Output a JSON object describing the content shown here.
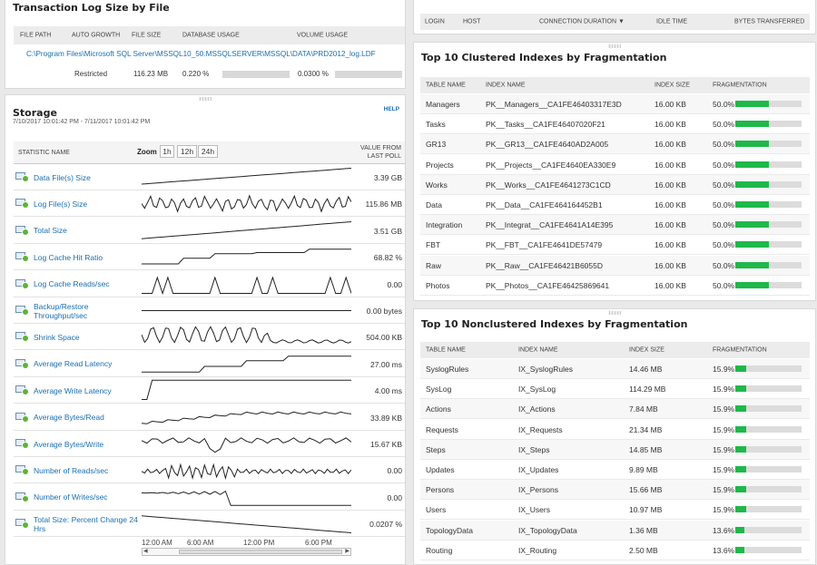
{
  "transaction_log": {
    "title": "Transaction Log Size by File",
    "headers": [
      "FILE PATH",
      "AUTO GROWTH",
      "FILE SIZE",
      "DATABASE USAGE",
      "VOLUME USAGE"
    ],
    "file_path": "C:\\Program Files\\Microsoft SQL Server\\MSSQL10_50.MSSQLSERVER\\MSSQL\\DATA\\PRD2012_log.LDF",
    "auto_growth": "Restricted",
    "file_size": "116.23 MB",
    "database_usage": "0.220 %",
    "volume_usage": "0.0300 %"
  },
  "storage": {
    "title": "Storage",
    "date_range": "7/10/2017 10:01:42 PM - 7/11/2017 10:01:42 PM",
    "help": "HELP",
    "col_stat": "STATISTIC NAME",
    "zoom_label": "Zoom",
    "zoom_options": [
      "1h",
      "12h",
      "24h"
    ],
    "col_value_1": "VALUE FROM",
    "col_value_2": "LAST POLL",
    "rows": [
      {
        "name": "Data File(s) Size",
        "value": "3.39 GB"
      },
      {
        "name": "Log File(s) Size",
        "value": "115.86 MB"
      },
      {
        "name": "Total Size",
        "value": "3.51 GB"
      },
      {
        "name": "Log Cache Hit Ratio",
        "value": "68.82 %"
      },
      {
        "name": "Log Cache Reads/sec",
        "value": "0.00"
      },
      {
        "name": "Backup/Restore Throughput/sec",
        "value": "0.00 bytes"
      },
      {
        "name": "Shrink Space",
        "value": "504.00 KB"
      },
      {
        "name": "Average Read Latency",
        "value": "27.00 ms"
      },
      {
        "name": "Average Write Latency",
        "value": "4.00 ms"
      },
      {
        "name": "Average Bytes/Read",
        "value": "33.89 KB"
      },
      {
        "name": "Average Bytes/Write",
        "value": "15.67 KB"
      },
      {
        "name": "Number of Reads/sec",
        "value": "0.00"
      },
      {
        "name": "Number of Writes/sec",
        "value": "0.00"
      },
      {
        "name": "Total Size: Percent Change 24 Hrs",
        "value": "0.0207 %"
      }
    ],
    "axis_ticks": [
      "12:00 AM",
      "6:00 AM",
      "12:00 PM",
      "6:00 PM"
    ]
  },
  "connections": {
    "headers": [
      "LOGIN",
      "HOST",
      "CONNECTION DURATION",
      "IDLE TIME",
      "BYTES TRANSFERRED"
    ]
  },
  "clustered": {
    "title": "Top 10 Clustered Indexes by Fragmentation",
    "headers": [
      "TABLE NAME",
      "INDEX NAME",
      "INDEX SIZE",
      "FRAGMENTATION"
    ],
    "rows": [
      {
        "table": "Managers",
        "index": "PK__Managers__CA1FE46403317E3D",
        "size": "16.00 KB",
        "frag": "50.0%",
        "frag_value": 50.0
      },
      {
        "table": "Tasks",
        "index": "PK__Tasks__CA1FE46407020F21",
        "size": "16.00 KB",
        "frag": "50.0%",
        "frag_value": 50.0
      },
      {
        "table": "GR13",
        "index": "PK__GR13__CA1FE4640AD2A005",
        "size": "16.00 KB",
        "frag": "50.0%",
        "frag_value": 50.0
      },
      {
        "table": "Projects",
        "index": "PK__Projects__CA1FE4640EA330E9",
        "size": "16.00 KB",
        "frag": "50.0%",
        "frag_value": 50.0
      },
      {
        "table": "Works",
        "index": "PK__Works__CA1FE4641273C1CD",
        "size": "16.00 KB",
        "frag": "50.0%",
        "frag_value": 50.0
      },
      {
        "table": "Data",
        "index": "PK__Data__CA1FE464164452B1",
        "size": "16.00 KB",
        "frag": "50.0%",
        "frag_value": 50.0
      },
      {
        "table": "Integration",
        "index": "PK__Integrat__CA1FE4641A14E395",
        "size": "16.00 KB",
        "frag": "50.0%",
        "frag_value": 50.0
      },
      {
        "table": "FBT",
        "index": "PK__FBT__CA1FE4641DE57479",
        "size": "16.00 KB",
        "frag": "50.0%",
        "frag_value": 50.0
      },
      {
        "table": "Raw",
        "index": "PK__Raw__CA1FE46421B6055D",
        "size": "16.00 KB",
        "frag": "50.0%",
        "frag_value": 50.0
      },
      {
        "table": "Photos",
        "index": "PK__Photos__CA1FE46425869641",
        "size": "16.00 KB",
        "frag": "50.0%",
        "frag_value": 50.0
      }
    ]
  },
  "nonclustered": {
    "title": "Top 10 Nonclustered Indexes by Fragmentation",
    "headers": [
      "TABLE NAME",
      "INDEX NAME",
      "INDEX SIZE",
      "FRAGMENTATION"
    ],
    "rows": [
      {
        "table": "SyslogRules",
        "index": "IX_SyslogRules",
        "size": "14.46 MB",
        "frag": "15.9%",
        "frag_value": 15.9
      },
      {
        "table": "SysLog",
        "index": "IX_SysLog",
        "size": "114.29 MB",
        "frag": "15.9%",
        "frag_value": 15.9
      },
      {
        "table": "Actions",
        "index": "IX_Actions",
        "size": "7.84 MB",
        "frag": "15.9%",
        "frag_value": 15.9
      },
      {
        "table": "Requests",
        "index": "IX_Requests",
        "size": "21.34 MB",
        "frag": "15.9%",
        "frag_value": 15.9
      },
      {
        "table": "Steps",
        "index": "IX_Steps",
        "size": "14.85 MB",
        "frag": "15.9%",
        "frag_value": 15.9
      },
      {
        "table": "Updates",
        "index": "IX_Updates",
        "size": "9.89 MB",
        "frag": "15.9%",
        "frag_value": 15.9
      },
      {
        "table": "Persons",
        "index": "IX_Persons",
        "size": "15.66 MB",
        "frag": "15.9%",
        "frag_value": 15.9
      },
      {
        "table": "Users",
        "index": "IX_Users",
        "size": "10.97 MB",
        "frag": "15.9%",
        "frag_value": 15.9
      },
      {
        "table": "TopologyData",
        "index": "IX_TopologyData",
        "size": "1.36 MB",
        "frag": "13.6%",
        "frag_value": 13.6
      },
      {
        "table": "Routing",
        "index": "IX_Routing",
        "size": "2.50 MB",
        "frag": "13.6%",
        "frag_value": 13.6
      }
    ]
  },
  "colors": {
    "link": "#1a6fb0",
    "frag_fill": "#1fb84a",
    "status_up": "#5bb33a"
  }
}
